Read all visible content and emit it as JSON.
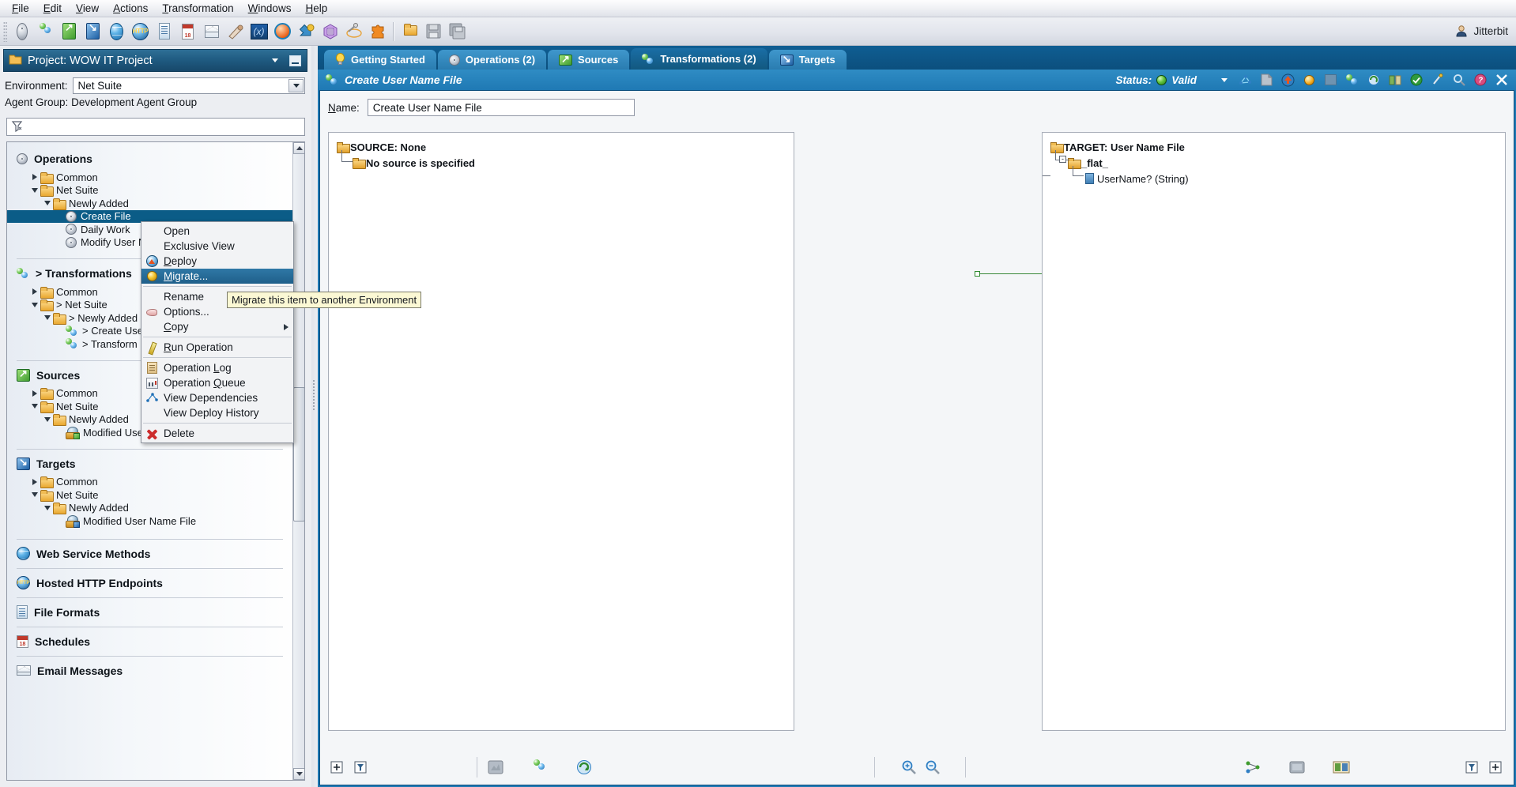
{
  "app": {
    "user_label": "Jitterbit",
    "accent_blue": "#1f79b4",
    "selection_blue": "#0b5c87",
    "tooltip_bg": "#fbf8d4"
  },
  "menubar": {
    "items": [
      {
        "label": "File",
        "mnemonic": "F"
      },
      {
        "label": "Edit",
        "mnemonic": "E"
      },
      {
        "label": "View",
        "mnemonic": "V"
      },
      {
        "label": "Actions",
        "mnemonic": "A"
      },
      {
        "label": "Transformation",
        "mnemonic": "T"
      },
      {
        "label": "Windows",
        "mnemonic": "W"
      },
      {
        "label": "Help",
        "mnemonic": "H"
      }
    ]
  },
  "toolbar": {
    "buttons": [
      {
        "name": "new-operation-icon",
        "glyph": "operation"
      },
      {
        "name": "new-transformation-icon",
        "glyph": "transformation"
      },
      {
        "name": "new-source-icon",
        "glyph": "source"
      },
      {
        "name": "new-target-icon",
        "glyph": "target"
      },
      {
        "name": "new-web-service-icon",
        "glyph": "globe"
      },
      {
        "name": "new-http-endpoint-icon",
        "glyph": "http"
      },
      {
        "name": "new-file-format-icon",
        "glyph": "file"
      },
      {
        "name": "new-schedule-icon",
        "glyph": "calendar"
      },
      {
        "name": "new-email-message-icon",
        "glyph": "mail"
      },
      {
        "name": "new-script-icon",
        "glyph": "script"
      },
      {
        "name": "new-variable-icon",
        "glyph": "variable"
      },
      {
        "name": "new-plugin-icon",
        "glyph": "orange-ball"
      },
      {
        "name": "deploy-icon",
        "glyph": "deploy-arrow"
      },
      {
        "name": "new-queue-icon",
        "glyph": "purple-hex"
      },
      {
        "name": "test-connection-icon",
        "glyph": "wand"
      },
      {
        "name": "plugins-icon",
        "glyph": "puzzle"
      },
      {
        "name": "open-project-icon",
        "glyph": "folder"
      },
      {
        "name": "save-icon",
        "glyph": "floppy"
      },
      {
        "name": "save-all-icon",
        "glyph": "floppy-multi"
      }
    ]
  },
  "left_panel": {
    "project_title": "Project: WOW IT Project",
    "environment_label": "Environment:",
    "environment_value": "Net Suite",
    "agent_group_label": "Agent Group:",
    "agent_group_value": "Development Agent Group",
    "search_placeholder": "",
    "sections": [
      {
        "name": "operations",
        "title": "Operations",
        "icon": "gear-icon",
        "nodes": [
          {
            "label": "Common",
            "depth": 1,
            "twisty": "right",
            "icon": "folder"
          },
          {
            "label": "Net Suite",
            "depth": 1,
            "twisty": "down",
            "icon": "folder"
          },
          {
            "label": "Newly Added",
            "depth": 2,
            "twisty": "down",
            "icon": "folder"
          },
          {
            "label": "Create File",
            "depth": 3,
            "twisty": "none",
            "icon": "operation",
            "selected": true
          },
          {
            "label": "Daily Work",
            "depth": 3,
            "twisty": "none",
            "icon": "operation"
          },
          {
            "label": "Modify User N",
            "depth": 3,
            "twisty": "none",
            "icon": "operation"
          }
        ]
      },
      {
        "name": "transformations",
        "title": "> Transformations",
        "icon": "transformation-icon",
        "nodes": [
          {
            "label": "Common",
            "depth": 1,
            "twisty": "right",
            "icon": "folder"
          },
          {
            "label": "> Net Suite",
            "depth": 1,
            "twisty": "down",
            "icon": "folder"
          },
          {
            "label": "> Newly Added",
            "depth": 2,
            "twisty": "down",
            "icon": "folder"
          },
          {
            "label": "> Create Use",
            "depth": 3,
            "twisty": "none",
            "icon": "transformation"
          },
          {
            "label": "> Transform",
            "depth": 3,
            "twisty": "none",
            "icon": "transformation"
          }
        ]
      },
      {
        "name": "sources",
        "title": "Sources",
        "icon": "source-icon",
        "nodes": [
          {
            "label": "Common",
            "depth": 1,
            "twisty": "right",
            "icon": "folder"
          },
          {
            "label": "Net Suite",
            "depth": 1,
            "twisty": "down",
            "icon": "folder"
          },
          {
            "label": "Newly Added",
            "depth": 2,
            "twisty": "down",
            "icon": "folder"
          },
          {
            "label": "Modified User Name File",
            "depth": 3,
            "twisty": "none",
            "icon": "source-file"
          }
        ]
      },
      {
        "name": "targets",
        "title": "Targets",
        "icon": "target-icon",
        "nodes": [
          {
            "label": "Common",
            "depth": 1,
            "twisty": "right",
            "icon": "folder"
          },
          {
            "label": "Net Suite",
            "depth": 1,
            "twisty": "down",
            "icon": "folder"
          },
          {
            "label": "Newly Added",
            "depth": 2,
            "twisty": "down",
            "icon": "folder"
          },
          {
            "label": "Modified User Name File",
            "depth": 3,
            "twisty": "none",
            "icon": "target-file"
          }
        ]
      },
      {
        "name": "web-service-methods",
        "title": "Web Service Methods",
        "icon": "globe-icon",
        "nodes": []
      },
      {
        "name": "hosted-http-endpoints",
        "title": "Hosted HTTP Endpoints",
        "icon": "http-icon",
        "nodes": []
      },
      {
        "name": "file-formats",
        "title": "File Formats",
        "icon": "file-icon",
        "nodes": []
      },
      {
        "name": "schedules",
        "title": "Schedules",
        "icon": "calendar-icon",
        "nodes": []
      },
      {
        "name": "email-messages",
        "title": "Email Messages",
        "icon": "mail-icon",
        "nodes": []
      }
    ]
  },
  "context_menu": {
    "items": [
      {
        "label": "Open",
        "icon": null,
        "mnemonic": null
      },
      {
        "label": "Exclusive View",
        "icon": null,
        "mnemonic": null
      },
      {
        "label": "Deploy",
        "icon": "deploy-icon",
        "mnemonic": "D"
      },
      {
        "label": "Migrate...",
        "icon": "migrate-icon",
        "mnemonic": "M",
        "highlighted": true
      },
      {
        "separator": true
      },
      {
        "label": "Rename",
        "icon": null,
        "mnemonic": null
      },
      {
        "label": "Options...",
        "icon": "options-icon",
        "mnemonic": null
      },
      {
        "label": "Copy",
        "icon": null,
        "mnemonic": "C",
        "submenu": true
      },
      {
        "separator": true
      },
      {
        "label": "Run Operation",
        "icon": "run-icon",
        "mnemonic": "R"
      },
      {
        "separator": true
      },
      {
        "label": "Operation Log",
        "icon": "log-icon",
        "mnemonic": "L"
      },
      {
        "label": "Operation Queue",
        "icon": "queue-icon",
        "mnemonic": "Q"
      },
      {
        "label": "View Dependencies",
        "icon": "dependencies-icon",
        "mnemonic": null
      },
      {
        "label": "View Deploy History",
        "icon": null,
        "mnemonic": null
      },
      {
        "separator": true
      },
      {
        "label": "Delete",
        "icon": "delete-icon",
        "mnemonic": null
      }
    ]
  },
  "tooltip": {
    "text": "Migrate this item to another Environment"
  },
  "tabs": [
    {
      "label": "Getting Started",
      "icon": "lightbulb-icon",
      "active": false
    },
    {
      "label": "Operations (2)",
      "icon": "gear-icon",
      "active": false
    },
    {
      "label": "Sources",
      "icon": "source-icon",
      "active": false
    },
    {
      "label": "Transformations (2)",
      "icon": "transformation-icon",
      "active": true
    },
    {
      "label": "Targets",
      "icon": "target-icon",
      "active": false
    }
  ],
  "editor": {
    "title": "Create User Name File",
    "title_icon": "transformation-icon",
    "status_label": "Status:",
    "status_value": "Valid",
    "status_color": "#63c43f",
    "name_label": "Name:",
    "name_value": "Create User Name File",
    "status_buttons": [
      {
        "name": "view-dependencies-button",
        "glyph": "dependencies"
      },
      {
        "name": "documentation-button",
        "glyph": "page"
      },
      {
        "name": "deploy-button",
        "glyph": "deploy"
      },
      {
        "name": "migrate-button",
        "glyph": "orange-ball"
      },
      {
        "name": "disabled-button",
        "glyph": "grey-square"
      },
      {
        "name": "transformation-settings-button",
        "glyph": "transformation"
      },
      {
        "name": "refresh-button",
        "glyph": "refresh"
      },
      {
        "name": "mapping-button",
        "glyph": "mapping"
      },
      {
        "name": "validate-button",
        "glyph": "green-circle"
      },
      {
        "name": "auto-map-button",
        "glyph": "wand"
      },
      {
        "name": "search-button",
        "glyph": "magnifier"
      },
      {
        "name": "help-button",
        "glyph": "question"
      },
      {
        "name": "close-editor-button",
        "glyph": "close"
      }
    ],
    "source_tree": {
      "root": "SOURCE: None",
      "children": [
        {
          "label": "No source is specified",
          "depth": 1
        }
      ]
    },
    "target_tree": {
      "root": "TARGET: User Name File",
      "children": [
        {
          "label": "_flat_",
          "depth": 1,
          "expander": "-"
        },
        {
          "label": "UserName? (String)",
          "depth": 2,
          "field": true
        }
      ]
    },
    "bottom_toolbar": [
      {
        "name": "expand-all-button",
        "glyph": "plus-box"
      },
      {
        "name": "filter-button",
        "glyph": "funnel"
      },
      {
        "name": "preview-button",
        "glyph": "grey-square"
      },
      {
        "name": "transform-settings-button",
        "glyph": "transformation"
      },
      {
        "name": "refresh-mapping-button",
        "glyph": "refresh-green"
      },
      {
        "name": "zoom-in-button",
        "glyph": "magnifier-plus"
      },
      {
        "name": "zoom-out-button",
        "glyph": "magnifier-minus"
      },
      {
        "name": "map-fields-button",
        "glyph": "map-nodes"
      },
      {
        "name": "clear-mapping-button",
        "glyph": "grey-block"
      },
      {
        "name": "test-mapping-button",
        "glyph": "test-grid"
      },
      {
        "name": "filter-right-button",
        "glyph": "funnel"
      },
      {
        "name": "expand-right-button",
        "glyph": "plus-box"
      }
    ]
  }
}
